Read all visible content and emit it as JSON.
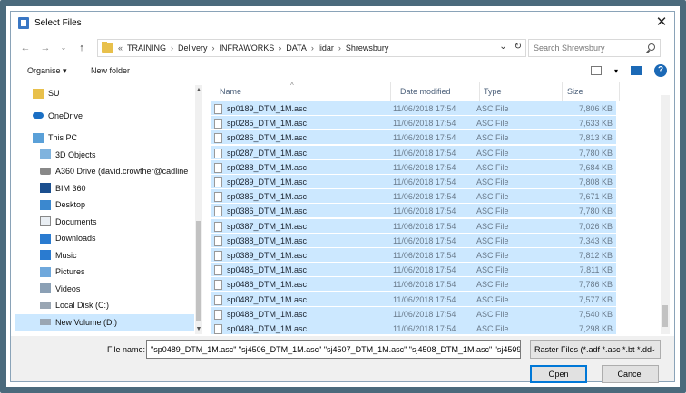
{
  "window": {
    "title": "Select Files"
  },
  "address": {
    "crumbs": [
      "TRAINING",
      "Delivery",
      "INFRAWORKS",
      "DATA",
      "lidar",
      "Shrewsbury"
    ],
    "prefix": "«",
    "sep": "›"
  },
  "search": {
    "placeholder": "Search Shrewsbury"
  },
  "toolbar": {
    "organise": "Organise ▾",
    "new_folder": "New folder"
  },
  "sidebar": {
    "items": [
      {
        "label": "SU",
        "icon": "user-folder-icon"
      },
      {
        "label": "OneDrive",
        "icon": "onedrive-cloud-icon"
      },
      {
        "label": "This PC",
        "icon": "computer-icon"
      },
      {
        "label": "3D Objects",
        "icon": "3d-objects-icon"
      },
      {
        "label": "A360 Drive (david.crowther@cadline",
        "icon": "a360-drive-icon"
      },
      {
        "label": "BIM 360",
        "icon": "bim360-icon"
      },
      {
        "label": "Desktop",
        "icon": "desktop-icon"
      },
      {
        "label": "Documents",
        "icon": "documents-icon"
      },
      {
        "label": "Downloads",
        "icon": "downloads-icon"
      },
      {
        "label": "Music",
        "icon": "music-icon"
      },
      {
        "label": "Pictures",
        "icon": "pictures-icon"
      },
      {
        "label": "Videos",
        "icon": "videos-icon"
      },
      {
        "label": "Local Disk (C:)",
        "icon": "local-disk-icon"
      },
      {
        "label": "New Volume (D:)",
        "icon": "drive-icon"
      }
    ]
  },
  "columns": {
    "name": "Name",
    "date": "Date modified",
    "type": "Type",
    "size": "Size"
  },
  "files": [
    {
      "name": "sp0189_DTM_1M.asc",
      "date": "11/06/2018 17:54",
      "type": "ASC File",
      "size": "7,806 KB"
    },
    {
      "name": "sp0285_DTM_1M.asc",
      "date": "11/06/2018 17:54",
      "type": "ASC File",
      "size": "7,633 KB"
    },
    {
      "name": "sp0286_DTM_1M.asc",
      "date": "11/06/2018 17:54",
      "type": "ASC File",
      "size": "7,813 KB"
    },
    {
      "name": "sp0287_DTM_1M.asc",
      "date": "11/06/2018 17:54",
      "type": "ASC File",
      "size": "7,780 KB"
    },
    {
      "name": "sp0288_DTM_1M.asc",
      "date": "11/06/2018 17:54",
      "type": "ASC File",
      "size": "7,684 KB"
    },
    {
      "name": "sp0289_DTM_1M.asc",
      "date": "11/06/2018 17:54",
      "type": "ASC File",
      "size": "7,808 KB"
    },
    {
      "name": "sp0385_DTM_1M.asc",
      "date": "11/06/2018 17:54",
      "type": "ASC File",
      "size": "7,671 KB"
    },
    {
      "name": "sp0386_DTM_1M.asc",
      "date": "11/06/2018 17:54",
      "type": "ASC File",
      "size": "7,780 KB"
    },
    {
      "name": "sp0387_DTM_1M.asc",
      "date": "11/06/2018 17:54",
      "type": "ASC File",
      "size": "7,026 KB"
    },
    {
      "name": "sp0388_DTM_1M.asc",
      "date": "11/06/2018 17:54",
      "type": "ASC File",
      "size": "7,343 KB"
    },
    {
      "name": "sp0389_DTM_1M.asc",
      "date": "11/06/2018 17:54",
      "type": "ASC File",
      "size": "7,812 KB"
    },
    {
      "name": "sp0485_DTM_1M.asc",
      "date": "11/06/2018 17:54",
      "type": "ASC File",
      "size": "7,811 KB"
    },
    {
      "name": "sp0486_DTM_1M.asc",
      "date": "11/06/2018 17:54",
      "type": "ASC File",
      "size": "7,786 KB"
    },
    {
      "name": "sp0487_DTM_1M.asc",
      "date": "11/06/2018 17:54",
      "type": "ASC File",
      "size": "7,577 KB"
    },
    {
      "name": "sp0488_DTM_1M.asc",
      "date": "11/06/2018 17:54",
      "type": "ASC File",
      "size": "7,540 KB"
    },
    {
      "name": "sp0489_DTM_1M.asc",
      "date": "11/06/2018 17:54",
      "type": "ASC File",
      "size": "7,298 KB"
    }
  ],
  "footer": {
    "filename_label": "File name:",
    "filename_value": "\"sp0489_DTM_1M.asc\" \"sj4506_DTM_1M.asc\" \"sj4507_DTM_1M.asc\" \"sj4508_DTM_1M.asc\" \"sj4509_",
    "filter": "Raster Files (*.adf *.asc *.bt *.dd",
    "open": "Open",
    "cancel": "Cancel"
  },
  "colors": {
    "selection": "#cce8ff",
    "accent": "#0078d7",
    "frame": "#4b6a7c"
  }
}
